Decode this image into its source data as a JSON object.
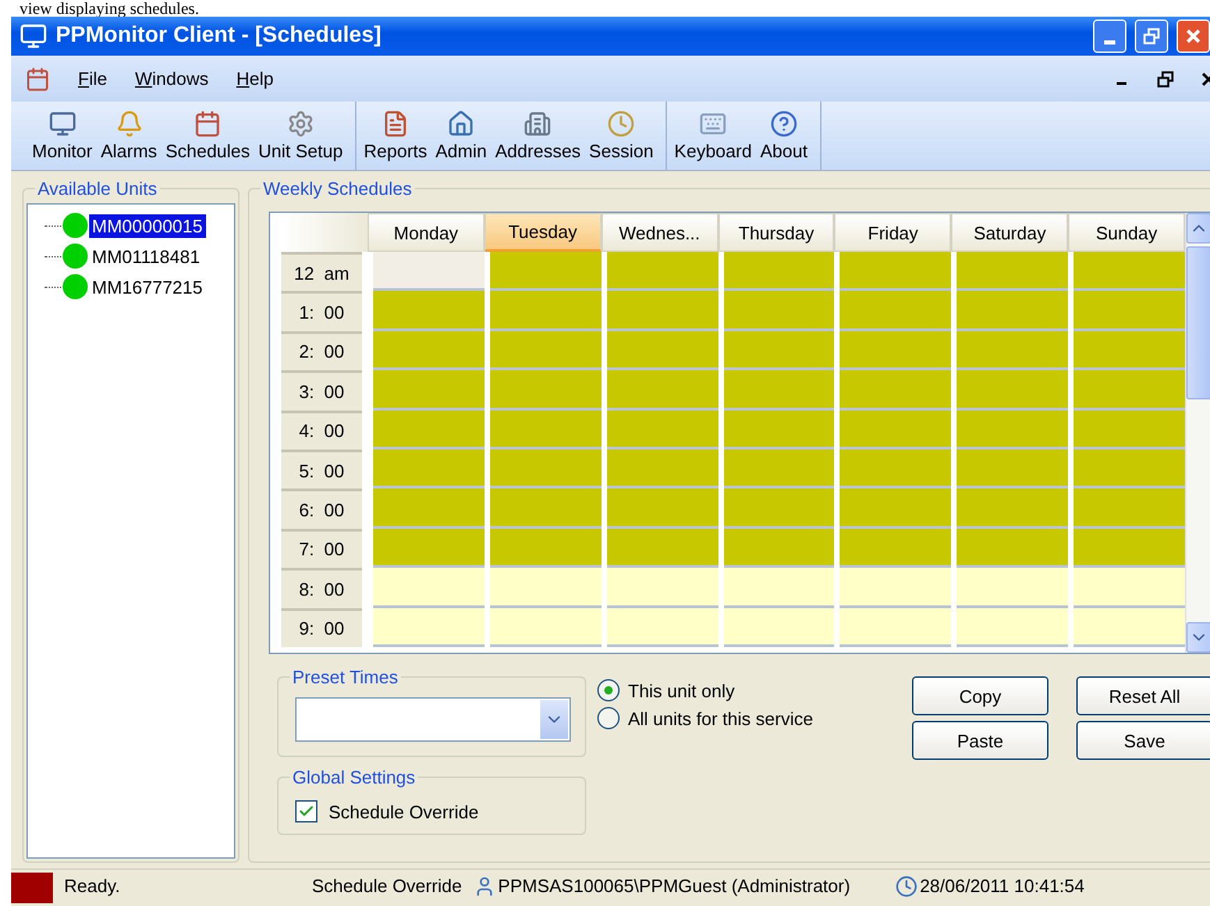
{
  "caption": "view displaying schedules.",
  "window": {
    "title": "PPMonitor Client - [Schedules]"
  },
  "menu": [
    "File",
    "Windows",
    "Help"
  ],
  "toolbar": [
    [
      {
        "label": "Monitor",
        "kind": "monitor"
      },
      {
        "label": "Alarms",
        "kind": "bell"
      },
      {
        "label": "Schedules",
        "kind": "calendar"
      },
      {
        "label": "Unit Setup",
        "kind": "gear"
      }
    ],
    [
      {
        "label": "Reports",
        "kind": "report"
      },
      {
        "label": "Admin",
        "kind": "home"
      },
      {
        "label": "Addresses",
        "kind": "building"
      },
      {
        "label": "Session",
        "kind": "clock"
      }
    ],
    [
      {
        "label": "Keyboard",
        "kind": "keyboard"
      },
      {
        "label": "About",
        "kind": "help"
      }
    ]
  ],
  "units": {
    "title": "Available Units",
    "items": [
      {
        "name": "MM00000015",
        "selected": true
      },
      {
        "name": "MM01118481",
        "selected": false
      },
      {
        "name": "MM16777215",
        "selected": false
      }
    ]
  },
  "schedule": {
    "title": "Weekly Schedules",
    "times": [
      "12  am",
      "1:  00",
      "2:  00",
      "3:  00",
      "4:  00",
      "5:  00",
      "6:  00",
      "7:  00",
      "8:  00",
      "9:  00"
    ],
    "days": [
      {
        "label": "Monday",
        "selected": false,
        "cells": [
          {
            "on": false,
            "selected": true
          },
          {
            "on": true,
            "selected": false
          },
          {
            "on": true,
            "selected": false
          },
          {
            "on": true,
            "selected": false
          },
          {
            "on": true,
            "selected": false
          },
          {
            "on": true,
            "selected": false
          },
          {
            "on": true,
            "selected": false
          },
          {
            "on": true,
            "selected": false
          },
          {
            "on": false,
            "selected": false
          },
          {
            "on": false,
            "selected": false
          }
        ]
      },
      {
        "label": "Tuesday",
        "selected": true,
        "cells": [
          {
            "on": true,
            "selected": false
          },
          {
            "on": true,
            "selected": false
          },
          {
            "on": true,
            "selected": false
          },
          {
            "on": true,
            "selected": false
          },
          {
            "on": true,
            "selected": false
          },
          {
            "on": true,
            "selected": false
          },
          {
            "on": true,
            "selected": false
          },
          {
            "on": true,
            "selected": false
          },
          {
            "on": false,
            "selected": false
          },
          {
            "on": false,
            "selected": false
          }
        ]
      },
      {
        "label": "Wednes...",
        "selected": false,
        "cells": [
          {
            "on": true,
            "selected": false
          },
          {
            "on": true,
            "selected": false
          },
          {
            "on": true,
            "selected": false
          },
          {
            "on": true,
            "selected": false
          },
          {
            "on": true,
            "selected": false
          },
          {
            "on": true,
            "selected": false
          },
          {
            "on": true,
            "selected": false
          },
          {
            "on": true,
            "selected": false
          },
          {
            "on": false,
            "selected": false
          },
          {
            "on": false,
            "selected": false
          }
        ]
      },
      {
        "label": "Thursday",
        "selected": false,
        "cells": [
          {
            "on": true,
            "selected": false
          },
          {
            "on": true,
            "selected": false
          },
          {
            "on": true,
            "selected": false
          },
          {
            "on": true,
            "selected": false
          },
          {
            "on": true,
            "selected": false
          },
          {
            "on": true,
            "selected": false
          },
          {
            "on": true,
            "selected": false
          },
          {
            "on": true,
            "selected": false
          },
          {
            "on": false,
            "selected": false
          },
          {
            "on": false,
            "selected": false
          }
        ]
      },
      {
        "label": "Friday",
        "selected": false,
        "cells": [
          {
            "on": true,
            "selected": false
          },
          {
            "on": true,
            "selected": false
          },
          {
            "on": true,
            "selected": false
          },
          {
            "on": true,
            "selected": false
          },
          {
            "on": true,
            "selected": false
          },
          {
            "on": true,
            "selected": false
          },
          {
            "on": true,
            "selected": false
          },
          {
            "on": true,
            "selected": false
          },
          {
            "on": false,
            "selected": false
          },
          {
            "on": false,
            "selected": false
          }
        ]
      },
      {
        "label": "Saturday",
        "selected": false,
        "cells": [
          {
            "on": true,
            "selected": false
          },
          {
            "on": true,
            "selected": false
          },
          {
            "on": true,
            "selected": false
          },
          {
            "on": true,
            "selected": false
          },
          {
            "on": true,
            "selected": false
          },
          {
            "on": true,
            "selected": false
          },
          {
            "on": true,
            "selected": false
          },
          {
            "on": true,
            "selected": false
          },
          {
            "on": false,
            "selected": false
          },
          {
            "on": false,
            "selected": false
          }
        ]
      },
      {
        "label": "Sunday",
        "selected": false,
        "cells": [
          {
            "on": true,
            "selected": false
          },
          {
            "on": true,
            "selected": false
          },
          {
            "on": true,
            "selected": false
          },
          {
            "on": true,
            "selected": false
          },
          {
            "on": true,
            "selected": false
          },
          {
            "on": true,
            "selected": false
          },
          {
            "on": true,
            "selected": false
          },
          {
            "on": true,
            "selected": false
          },
          {
            "on": false,
            "selected": false
          },
          {
            "on": false,
            "selected": false
          }
        ]
      }
    ]
  },
  "preset": {
    "title": "Preset Times"
  },
  "scope": [
    {
      "label": "This unit only",
      "selected": true
    },
    {
      "label": "All units for this service",
      "selected": false
    }
  ],
  "buttons": [
    "Copy",
    "Paste",
    "Reset All",
    "Save"
  ],
  "global": {
    "title": "Global Settings",
    "override": {
      "label": "Schedule Override",
      "checked": true
    }
  },
  "status": {
    "text": "Ready.",
    "mode": "Schedule Override",
    "user": "PPMSAS100065\\PPMGuest (Administrator)",
    "time": "28/06/2011 10:41:54"
  }
}
